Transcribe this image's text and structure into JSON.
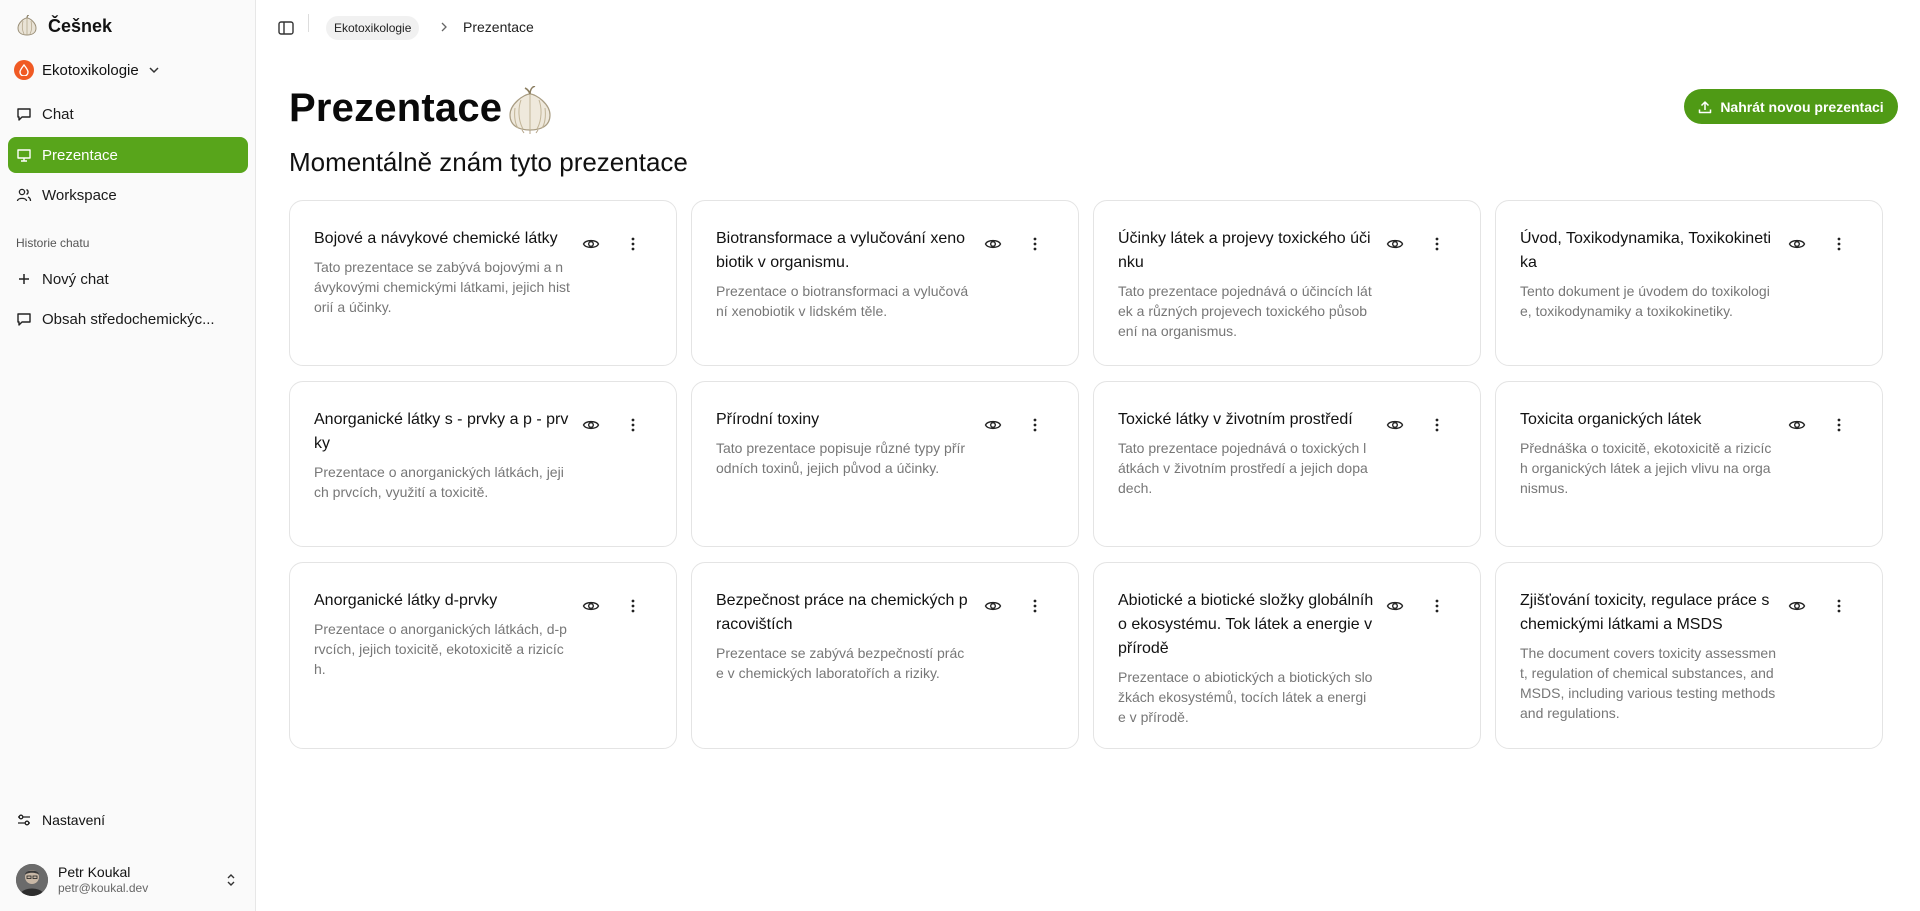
{
  "app": {
    "name": "Češnek"
  },
  "org": {
    "name": "Ekotoxikologie"
  },
  "nav": [
    {
      "label": "Chat",
      "icon": "chat-icon"
    },
    {
      "label": "Prezentace",
      "icon": "presentation-icon",
      "active": true
    },
    {
      "label": "Workspace",
      "icon": "users-icon"
    }
  ],
  "history": {
    "label": "Historie chatu",
    "new_chat": "Nový chat",
    "items": [
      "Obsah středochemickýc..."
    ]
  },
  "settings_label": "Nastavení",
  "user": {
    "name": "Petr Koukal",
    "email": "petr@koukal.dev"
  },
  "breadcrumb": [
    "Ekotoxikologie",
    "Prezentace"
  ],
  "page": {
    "title": "Prezentace",
    "subtitle": "Momentálně znám tyto prezentace",
    "upload_label": "Nahrát novou prezentaci"
  },
  "accent_color": "#58a51b",
  "cards": [
    {
      "title": "Bojové a návykové chemické látky",
      "description": "Tato prezentace se zabývá bojovými a návykovými chemickými látkami, jejich historií a účinky."
    },
    {
      "title": "Biotransformace a vylučování xenobiotik v organismu.",
      "description": "Prezentace o biotransformaci a vylučování xenobiotik v lidském těle."
    },
    {
      "title": "Účinky látek a projevy toxického účinku",
      "description": "Tato prezentace pojednává o účincích látek a různých projevech toxického působení na organismus."
    },
    {
      "title": "Úvod, Toxikodynamika, Toxikokinetika",
      "description": "Tento dokument je úvodem do toxikologie, toxikodynamiky a toxikokinetiky."
    },
    {
      "title": "Anorganické látky s - prvky a p - prvky",
      "description": "Prezentace o anorganických látkách, jejich prvcích, využití a toxicitě."
    },
    {
      "title": "Přírodní toxiny",
      "description": "Tato prezentace popisuje různé typy přírodních toxinů, jejich původ a účinky."
    },
    {
      "title": "Toxické látky v životním prostředí",
      "description": "Tato prezentace pojednává o toxických látkách v životním prostředí a jejich dopadech."
    },
    {
      "title": "Toxicita organických látek",
      "description": "Přednáška o toxicitě, ekotoxicitě a rizicích organických látek a jejich vlivu na organismus."
    },
    {
      "title": "Anorganické látky d-prvky",
      "description": "Prezentace o anorganických látkách, d-prvcích, jejich toxicitě, ekotoxicitě a rizicích."
    },
    {
      "title": "Bezpečnost práce na chemických pracovištích",
      "description": "Prezentace se zabývá bezpečností práce v chemických laboratořích a riziky."
    },
    {
      "title": "Abiotické a biotické složky globálního ekosystému. Tok látek a energie v přírodě",
      "description": "Prezentace o abiotických a biotických složkách ekosystémů, tocích látek a energie v přírodě."
    },
    {
      "title": "Zjišťování toxicity, regulace práce s chemickými látkami a MSDS",
      "description": "The document covers toxicity assessment, regulation of chemical substances, and MSDS, including various testing methods and regulations."
    }
  ]
}
